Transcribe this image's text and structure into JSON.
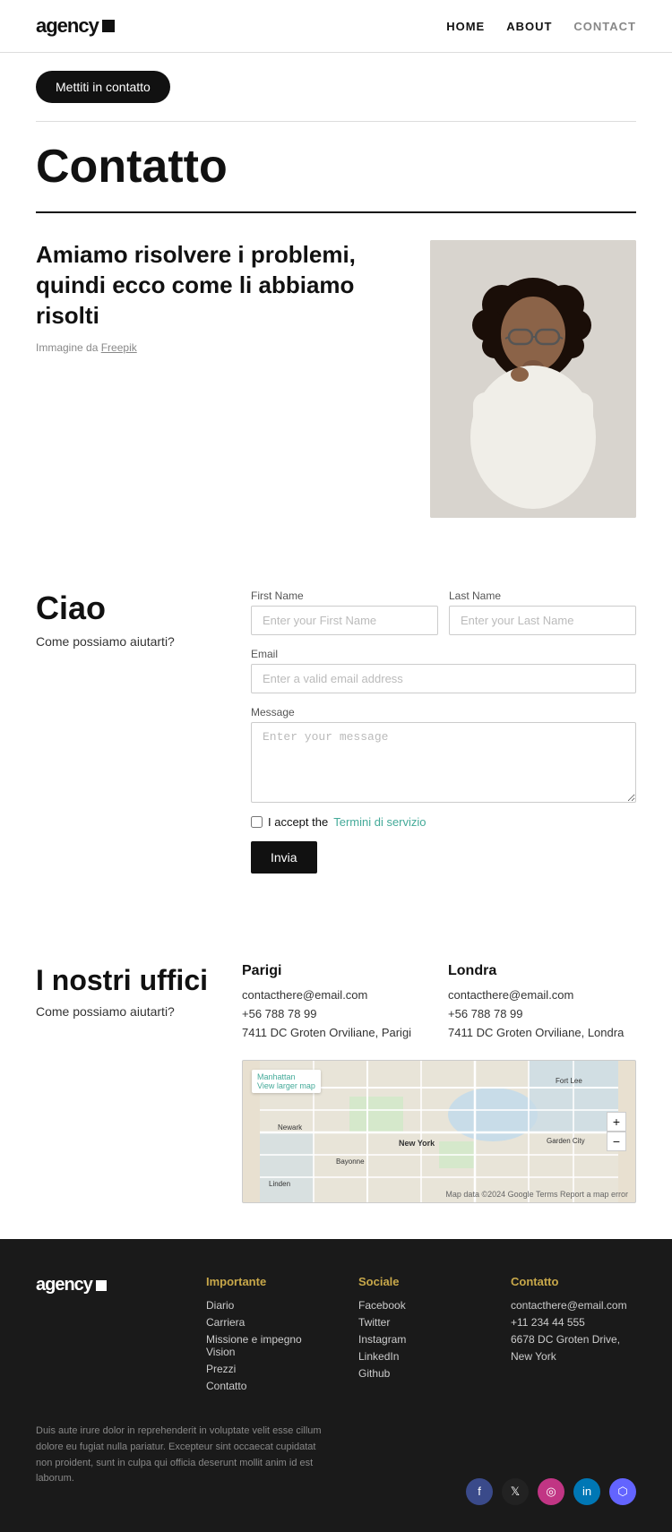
{
  "nav": {
    "logo_text": "agency",
    "links": [
      {
        "id": "home",
        "label": "HOME",
        "active": false
      },
      {
        "id": "about",
        "label": "ABOUT",
        "active": false
      },
      {
        "id": "contact",
        "label": "CONTACT",
        "active": true
      }
    ]
  },
  "contact_button": {
    "label": "Mettiti in contatto"
  },
  "hero": {
    "title": "Contatto",
    "heading": "Amiamo risolvere i problemi, quindi ecco come li abbiamo risolti",
    "image_credit": "Immagine da",
    "image_credit_link": "Freepik"
  },
  "form_section": {
    "left_title": "Ciao",
    "left_subtitle": "Come possiamo aiutarti?",
    "first_name_label": "First Name",
    "first_name_placeholder": "Enter your First Name",
    "last_name_label": "Last Name",
    "last_name_placeholder": "Enter your Last Name",
    "email_label": "Email",
    "email_placeholder": "Enter a valid email address",
    "message_label": "Message",
    "message_placeholder": "Enter your message",
    "terms_text": "I accept the",
    "terms_link": "Termini di servizio",
    "submit_label": "Invia"
  },
  "offices": {
    "left_title": "I nostri uffici",
    "left_subtitle": "Come possiamo aiutarti?",
    "paris": {
      "title": "Parigi",
      "email": "contacthere@email.com",
      "phone": "+56 788 78 99",
      "address": "7411 DC Groten Orviliane, Parigi"
    },
    "london": {
      "title": "Londra",
      "email": "contacthere@email.com",
      "phone": "+56 788 78 99",
      "address": "7411 DC Groten Orviliane, Londra"
    },
    "map_label": "Manhattan",
    "map_link": "View larger map",
    "map_credits": "Map data ©2024 Google  Terms  Report a map error"
  },
  "footer": {
    "logo_text": "agency",
    "columns": [
      {
        "id": "importante",
        "title": "Importante",
        "items": [
          "Diario",
          "Carriera",
          "Missione e impegno Vision",
          "Prezzi",
          "Contatto"
        ]
      },
      {
        "id": "sociale",
        "title": "Sociale",
        "items": [
          "Facebook",
          "Twitter",
          "Instagram",
          "LinkedIn",
          "Github"
        ]
      },
      {
        "id": "contatto",
        "title": "Contatto",
        "items": [
          "contacthere@email.com",
          "+11 234 44 555",
          "6678 DC Groten Drive,",
          "New York"
        ]
      }
    ],
    "body_text": "Duis aute irure dolor in reprehenderit in voluptate velit esse cillum dolore eu fugiat nulla pariatur. Excepteur sint occaecat cupidatat non proident, sunt in culpa qui officia deserunt mollit anim id est laborum.",
    "social_icons": [
      {
        "id": "facebook",
        "glyph": "f",
        "color": "#3a4a8a"
      },
      {
        "id": "twitter",
        "glyph": "𝕏",
        "color": "#222"
      },
      {
        "id": "instagram",
        "glyph": "◎",
        "color": "#c13584"
      },
      {
        "id": "linkedin",
        "glyph": "in",
        "color": "#0077b5"
      },
      {
        "id": "mastodon",
        "glyph": "⬡",
        "color": "#6364ff"
      }
    ]
  }
}
